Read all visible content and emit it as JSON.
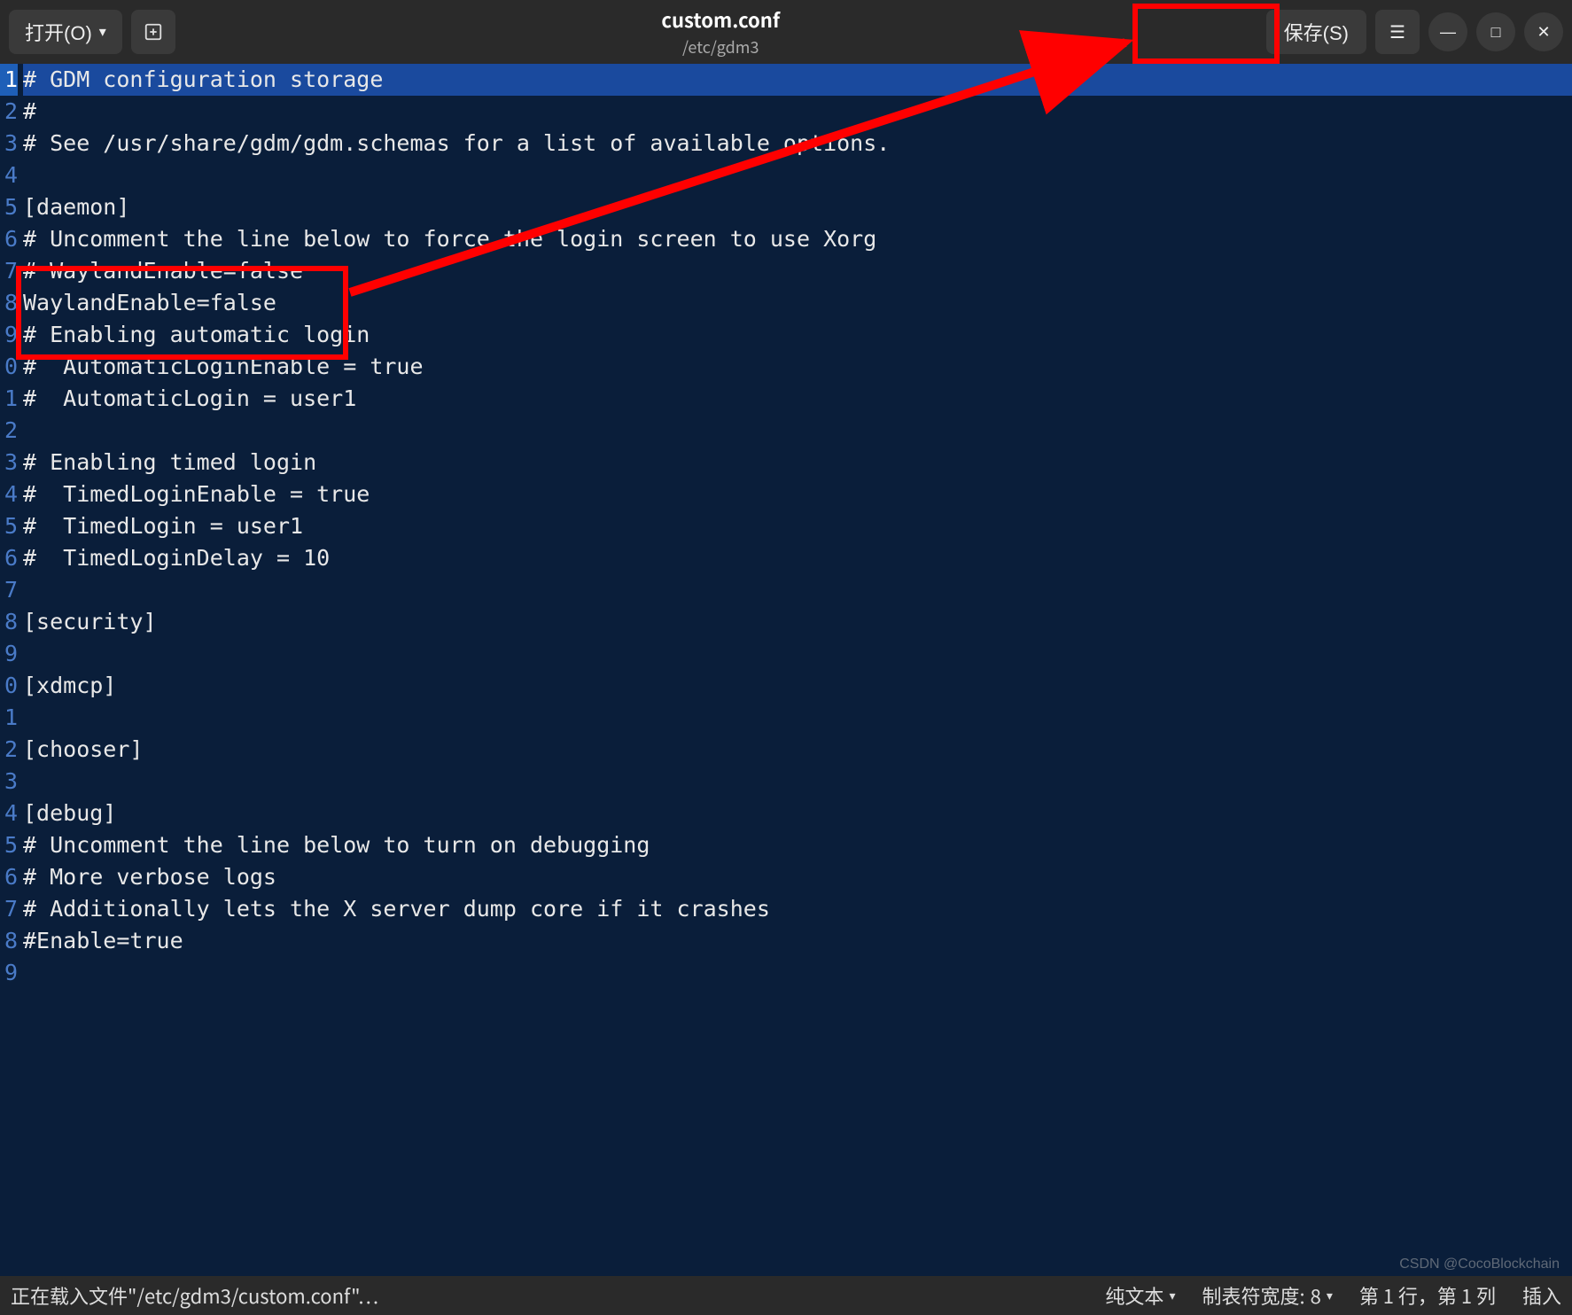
{
  "titlebar": {
    "open_label": "打开(O)",
    "title": "custom.conf",
    "subtitle": "/etc/gdm3",
    "save_label": "保存(S)"
  },
  "lines": [
    "# GDM configuration storage",
    "#",
    "# See /usr/share/gdm/gdm.schemas for a list of available options.",
    "",
    "[daemon]",
    "# Uncomment the line below to force the login screen to use Xorg",
    "# WaylandEnable=false",
    "WaylandEnable=false",
    "# Enabling automatic login",
    "#  AutomaticLoginEnable = true",
    "#  AutomaticLogin = user1",
    "",
    "# Enabling timed login",
    "#  TimedLoginEnable = true",
    "#  TimedLogin = user1",
    "#  TimedLoginDelay = 10",
    "",
    "[security]",
    "",
    "[xdmcp]",
    "",
    "[chooser]",
    "",
    "[debug]",
    "# Uncomment the line below to turn on debugging",
    "# More verbose logs",
    "# Additionally lets the X server dump core if it crashes",
    "#Enable=true",
    ""
  ],
  "gutter_numbers": [
    "1",
    "2",
    "3",
    "4",
    "5",
    "6",
    "7",
    "8",
    "9",
    "0",
    "1",
    "2",
    "3",
    "4",
    "5",
    "6",
    "7",
    "8",
    "9",
    "0",
    "1",
    "2",
    "3",
    "4",
    "5",
    "6",
    "7",
    "8",
    "9"
  ],
  "statusbar": {
    "loading": "正在载入文件\"/etc/gdm3/custom.conf\"…",
    "syntax": "纯文本",
    "tabwidth_label": "制表符宽度:",
    "tabwidth_value": "8",
    "position": "第 1 行，第 1 列",
    "mode": "插入"
  },
  "watermark": "CSDN @CocoBlockchain"
}
